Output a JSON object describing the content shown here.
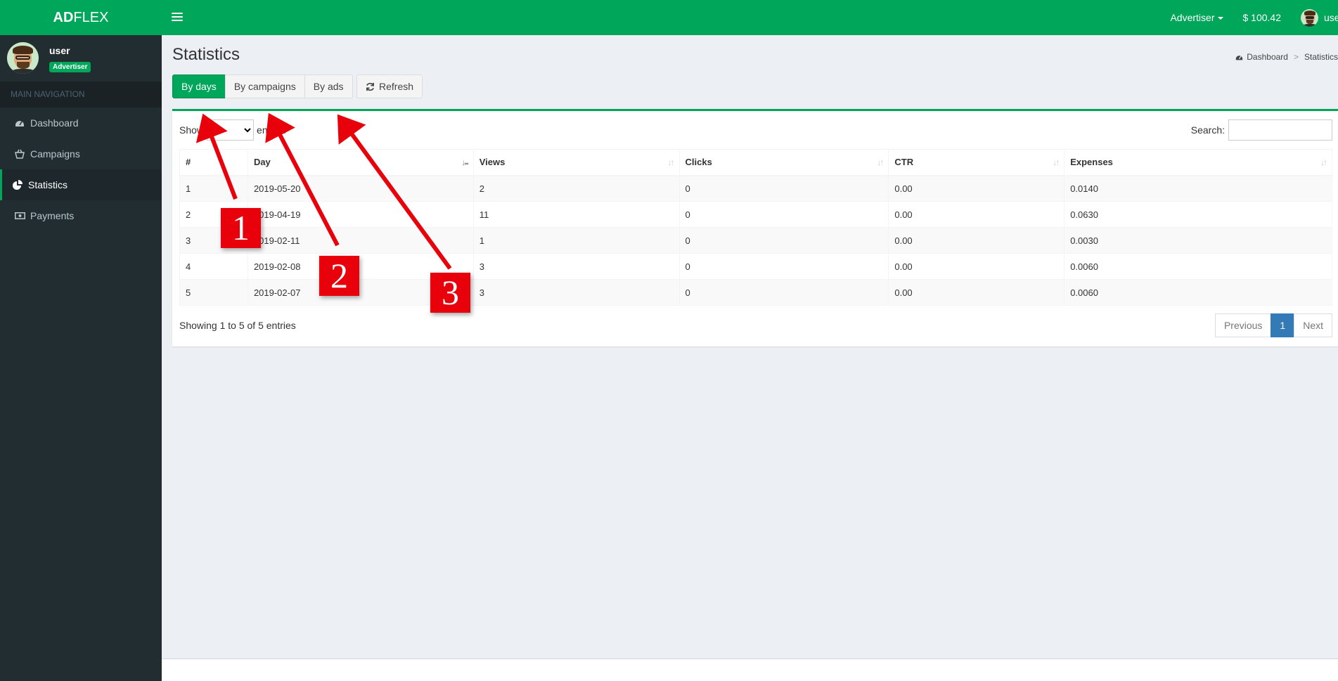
{
  "brand": {
    "bold": "AD",
    "rest": "FLEX"
  },
  "topnav": {
    "role": "Advertiser",
    "balance": "$ 100.42",
    "user": "user"
  },
  "sidebar": {
    "user_name": "user",
    "user_badge": "Advertiser",
    "nav_header": "MAIN NAVIGATION",
    "items": [
      {
        "label": "Dashboard",
        "icon": "dashboard-icon"
      },
      {
        "label": "Campaigns",
        "icon": "basket-icon"
      },
      {
        "label": "Statistics",
        "icon": "pie-chart-icon",
        "active": true
      },
      {
        "label": "Payments",
        "icon": "money-icon"
      }
    ]
  },
  "page": {
    "title": "Statistics"
  },
  "breadcrumb": {
    "home": "Dashboard",
    "current": "Statistics"
  },
  "tabs": {
    "by_days": "By days",
    "by_campaigns": "By campaigns",
    "by_ads": "By ads",
    "refresh": "Refresh"
  },
  "table_controls": {
    "show_label": "Show",
    "page_length": "10",
    "entries_label": "entries",
    "search_label": "Search:"
  },
  "table": {
    "columns": [
      "#",
      "Day",
      "Views",
      "Clicks",
      "CTR",
      "Expenses"
    ],
    "rows": [
      [
        "1",
        "2019-05-20",
        "2",
        "0",
        "0.00",
        "0.0140"
      ],
      [
        "2",
        "2019-04-19",
        "11",
        "0",
        "0.00",
        "0.0630"
      ],
      [
        "3",
        "2019-02-11",
        "1",
        "0",
        "0.00",
        "0.0030"
      ],
      [
        "4",
        "2019-02-08",
        "3",
        "0",
        "0.00",
        "0.0060"
      ],
      [
        "5",
        "2019-02-07",
        "3",
        "0",
        "0.00",
        "0.0060"
      ]
    ]
  },
  "footer_table": {
    "info": "Showing 1 to 5 of 5 entries",
    "prev": "Previous",
    "page": "1",
    "next": "Next"
  },
  "annotations": [
    "1",
    "2",
    "3"
  ],
  "colors": {
    "brand": "#00a65a",
    "sidebar": "#222d32",
    "annotation": "#e8000b",
    "pager_active": "#337ab7"
  }
}
